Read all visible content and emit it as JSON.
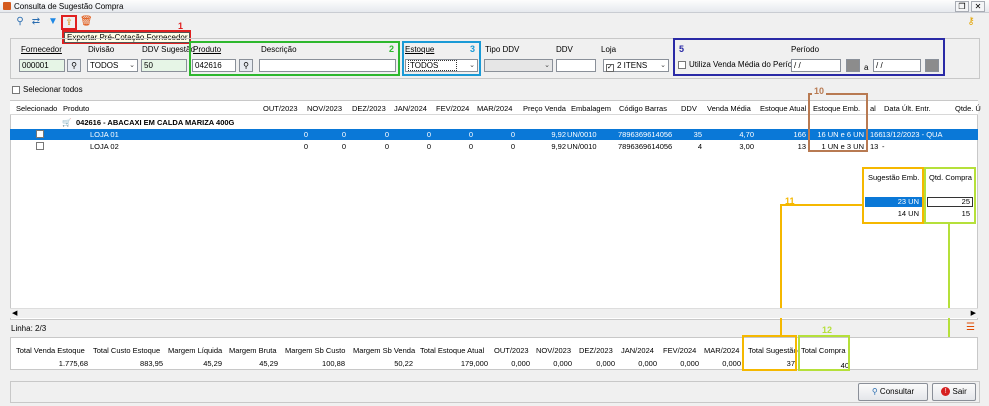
{
  "window": {
    "title": "Consulta de Sugestão Compra"
  },
  "toolbar": {
    "tooltip": "Exportar Pré-Cotação Fornecedor"
  },
  "annotations": [
    "1",
    "2",
    "3",
    "5",
    "10",
    "11",
    "12"
  ],
  "filters": {
    "fornecedor_label": "Fornecedor",
    "fornecedor_value": "000001",
    "divisao_label": "Divisão",
    "divisao_value": "TODOS",
    "ddv_sugestao_label": "DDV Sugestão",
    "ddv_sugestao_value": "50",
    "produto_label": "Produto",
    "produto_value": "042616",
    "descricao_label": "Descrição",
    "descricao_value": "",
    "estoque_label": "Estoque",
    "estoque_value": "TODOS",
    "tipo_ddv_label": "Tipo DDV",
    "tipo_ddv_value": "",
    "ddv_label": "DDV",
    "ddv_value": "",
    "loja_label": "Loja",
    "loja_value": "2 ITENS",
    "periodo_label": "Período",
    "utiliza_label": "Utiliza Venda Média do Período",
    "periodo_de": "/ /",
    "periodo_a_label": "a",
    "periodo_ate": "/ /",
    "selecionar_todos": "Selecionar todos"
  },
  "grid": {
    "headers": [
      "Selecionado",
      "Produto",
      "OUT/2023",
      "NOV/2023",
      "DEZ/2023",
      "JAN/2024",
      "FEV/2024",
      "MAR/2024",
      "Preço Venda",
      "Embalagem",
      "Código Barras",
      "DDV",
      "Venda Média",
      "Estoque Atual",
      "Estoque Emb.",
      "al",
      "Data Últ. Entr.",
      "Qtde. Ú"
    ],
    "group_title": "042616 - ABACAXI EM CALDA MARIZA 400G",
    "rows": [
      {
        "produto": "LOJA 01",
        "out": "0",
        "nov": "0",
        "dez": "0",
        "jan": "0",
        "fev": "0",
        "mar": "0",
        "preco": "9,92",
        "emb": "UN/0010",
        "barras": "7896369614056",
        "ddv": "35",
        "venda_media": "4,70",
        "estoque_atual": "166",
        "estoque_emb": "16 UN e 6 UN",
        "al": "166",
        "data_ult": "13/12/2023 - QUA",
        "qtde": ""
      },
      {
        "produto": "LOJA 02",
        "out": "0",
        "nov": "0",
        "dez": "0",
        "jan": "0",
        "fev": "0",
        "mar": "0",
        "preco": "9,92",
        "emb": "UN/0010",
        "barras": "7896369614056",
        "ddv": "4",
        "venda_media": "3,00",
        "estoque_atual": "13",
        "estoque_emb": "1 UN e 3 UN",
        "al": "13",
        "data_ult": "-",
        "qtde": ""
      }
    ],
    "side_headers": {
      "sugestao_emb": "Sugestão Emb.",
      "qtd_compra": "Qtd. Compra"
    },
    "side_rows": [
      {
        "sugestao_emb": "23 UN",
        "qtd_compra": "25"
      },
      {
        "sugestao_emb": "14 UN",
        "qtd_compra": "15"
      }
    ]
  },
  "status": {
    "linha": "Linha: 2/3"
  },
  "totals": {
    "headers": [
      "Total Venda Estoque",
      "Total Custo Estoque",
      "Margem Líquida",
      "Margem Bruta",
      "Margem Sb Custo",
      "Margem Sb Venda",
      "Total Estoque Atual",
      "OUT/2023",
      "NOV/2023",
      "DEZ/2023",
      "JAN/2024",
      "FEV/2024",
      "MAR/2024",
      "Total Sugestão",
      "Total Compra"
    ],
    "values": [
      "1.775,68",
      "883,95",
      "45,29",
      "45,29",
      "100,88",
      "50,22",
      "179,000",
      "0,000",
      "0,000",
      "0,000",
      "0,000",
      "0,000",
      "0,000",
      "37",
      "40"
    ]
  },
  "buttons": {
    "consultar": "Consultar",
    "sair": "Sair"
  },
  "colors": {
    "selected_row": "#0a78d7",
    "annot_red": "#e02020",
    "annot_green": "#2eb82e",
    "annot_blue": "#1a9ad6",
    "annot_navy": "#2a2aa6",
    "annot_brown": "#b87a52",
    "annot_orange": "#f5b800",
    "annot_lime": "#b5e03a"
  }
}
